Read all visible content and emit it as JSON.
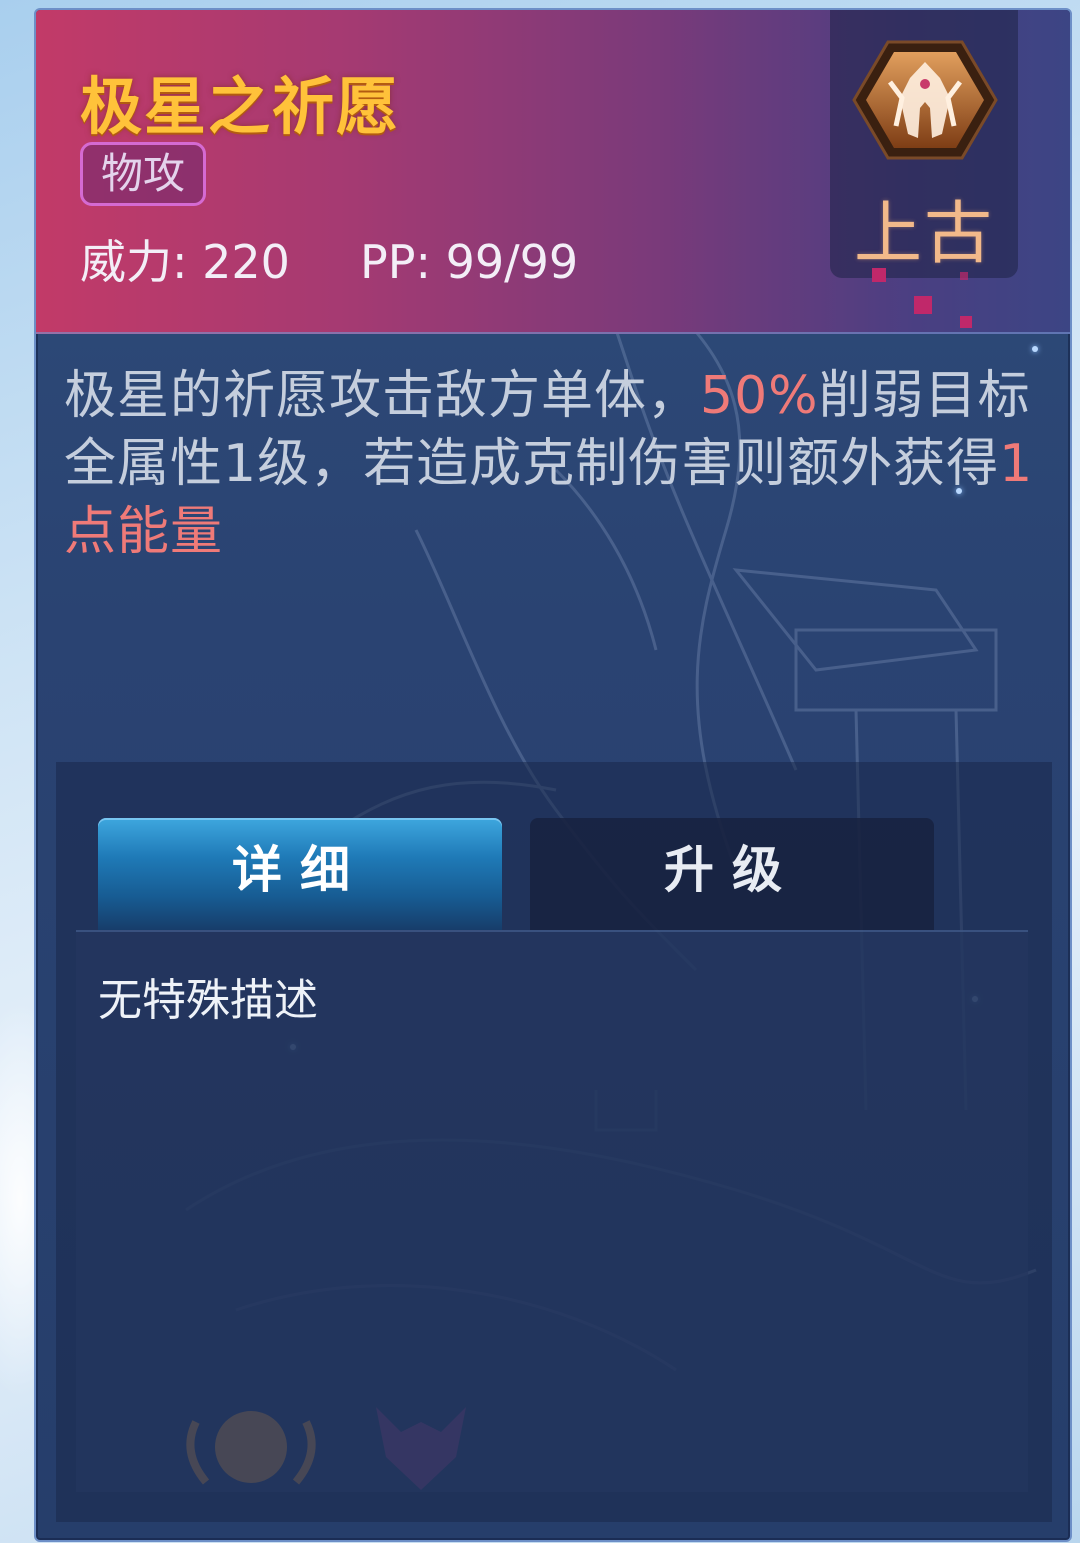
{
  "skill": {
    "name": "极星之祈愿",
    "category": "物攻",
    "power_text": "威力: 220",
    "pp_text": "PP: 99/99"
  },
  "rarity": {
    "label": "上古",
    "icon": "ancient-emblem-icon"
  },
  "description": {
    "part1": "极星的祈愿攻击敌方单体，",
    "highlight1": "50%",
    "part2": "削弱目标全属性1级，若造成克制伤害则额外获得",
    "highlight2": "1点能量"
  },
  "tabs": [
    {
      "label": "详细",
      "active": true
    },
    {
      "label": "升级",
      "active": false
    }
  ],
  "detail_text": "无特殊描述",
  "colors": {
    "title": "#ffc23a",
    "highlight": "#ef7a78",
    "tag_border": "#d56ad2",
    "rarity_text": "#f2b98a"
  }
}
